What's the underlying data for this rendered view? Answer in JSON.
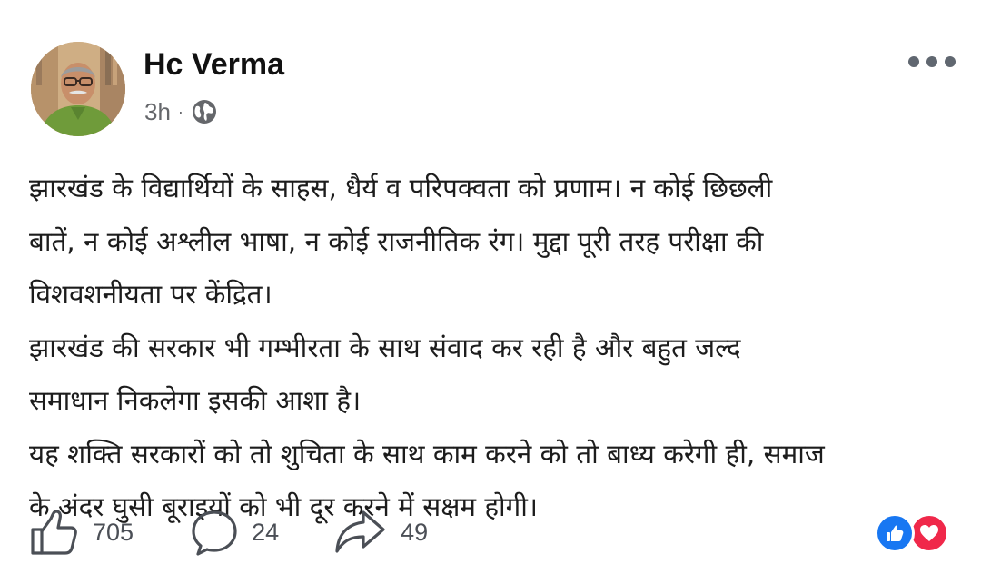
{
  "post": {
    "author": "Hc Verma",
    "time": "3h",
    "separator": "·",
    "privacy_icon": "globe-icon",
    "text_lines": [
      "झारखंड के विद्यार्थियों के साहस, धैर्य व परिपक्वता को प्रणाम। न कोई  छिछली",
      "बातें, न कोई अश्लील भाषा, न कोई राजनीतिक रंग। मुद्दा पूरी तरह परीक्षा की",
      "विशवशनीयता  पर केंद्रित।",
      "झारखंड की सरकार भी गम्भीरता के साथ संवाद  कर रही  है और बहुत जल्द",
      "समाधान निकलेगा इसकी आशा है।",
      "यह शक्ति सरकारों को तो शुचिता के साथ काम करने को तो बाध्य करेगी ही, समाज",
      "के अंदर घुसी बूराइयों को भी दूर करने में सक्षम होगी।"
    ]
  },
  "actions": {
    "likes": "705",
    "comments": "24",
    "shares": "49"
  },
  "icons": {
    "more": "more-options-icon",
    "like": "thumbs-up-icon",
    "comment": "comment-bubble-icon",
    "share": "share-arrow-icon",
    "reaction_like": "like-reaction-icon",
    "reaction_love": "love-reaction-icon"
  },
  "colors": {
    "meta_text": "#65676b",
    "like_blue": "#1877f2",
    "love_red": "#f0284a"
  }
}
